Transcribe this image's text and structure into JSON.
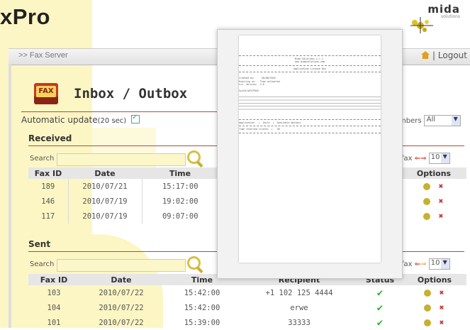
{
  "app": {
    "logo_text": "xPro",
    "brand": "mida",
    "brand_sub": "solutions"
  },
  "topbar": {
    "breadcrumb": ">> Fax Server",
    "logout": "| Logout"
  },
  "page": {
    "icon_label": "FAX",
    "title": "Inbox / Outbox"
  },
  "auto_update": {
    "label": "Automatic update",
    "interval": "(20 sec)",
    "checked": true
  },
  "filter": {
    "label": "mbers",
    "value": "All"
  },
  "received": {
    "heading": "Received",
    "search_label": "Search",
    "search_value": "",
    "pager": {
      "label": "fax",
      "per_page": "10"
    },
    "columns": [
      "Fax ID",
      "Date",
      "Time"
    ],
    "options_header": "Options",
    "rows": [
      {
        "id": "189",
        "date": "2010/07/21",
        "time": "15:17:00"
      },
      {
        "id": "146",
        "date": "2010/07/19",
        "time": "19:02:00"
      },
      {
        "id": "117",
        "date": "2010/07/19",
        "time": "09:07:00"
      }
    ]
  },
  "sent": {
    "heading": "Sent",
    "search_label": "Search",
    "search_value": "",
    "pager": {
      "label": "fax",
      "per_page": "10"
    },
    "columns": [
      "Fax ID",
      "Date",
      "Time",
      "Recipient",
      "Status",
      "Options"
    ],
    "rows": [
      {
        "id": "103",
        "date": "2010/07/22",
        "time": "15:42:00",
        "recipient": "+1 102 125 4444",
        "status": "ok"
      },
      {
        "id": "104",
        "date": "2010/07/22",
        "time": "15:42:00",
        "recipient": "erwe",
        "status": "ok"
      },
      {
        "id": "101",
        "date": "2010/07/22",
        "time": "15:39:00",
        "recipient": "33333",
        "status": "ok"
      }
    ]
  },
  "preview": {
    "lines": [
      "Mida Solutions s.r.l.",
      "www.midasolutions.com",
      "Application License Key",
      "Created on:     30/06/2010",
      "Expiring on:   Time unlimited",
      "Lic. Version:  2.0",
      "SysId:AE57F8A3",
      "Application   |  Units  |  Available Options",
      "Time reserved clients  |   30"
    ]
  },
  "colors": {
    "accent_rule": "#b7493a",
    "search_bg": "#fbf7c8",
    "header_bg": "#e6e6e6",
    "status_ok": "#33aa33"
  },
  "icons": [
    "house-icon",
    "fax-icon",
    "search-icon",
    "checkbox-icon",
    "arrow-left-icon",
    "arrow-right-icon",
    "options-icon",
    "delete-icon",
    "check-icon"
  ]
}
